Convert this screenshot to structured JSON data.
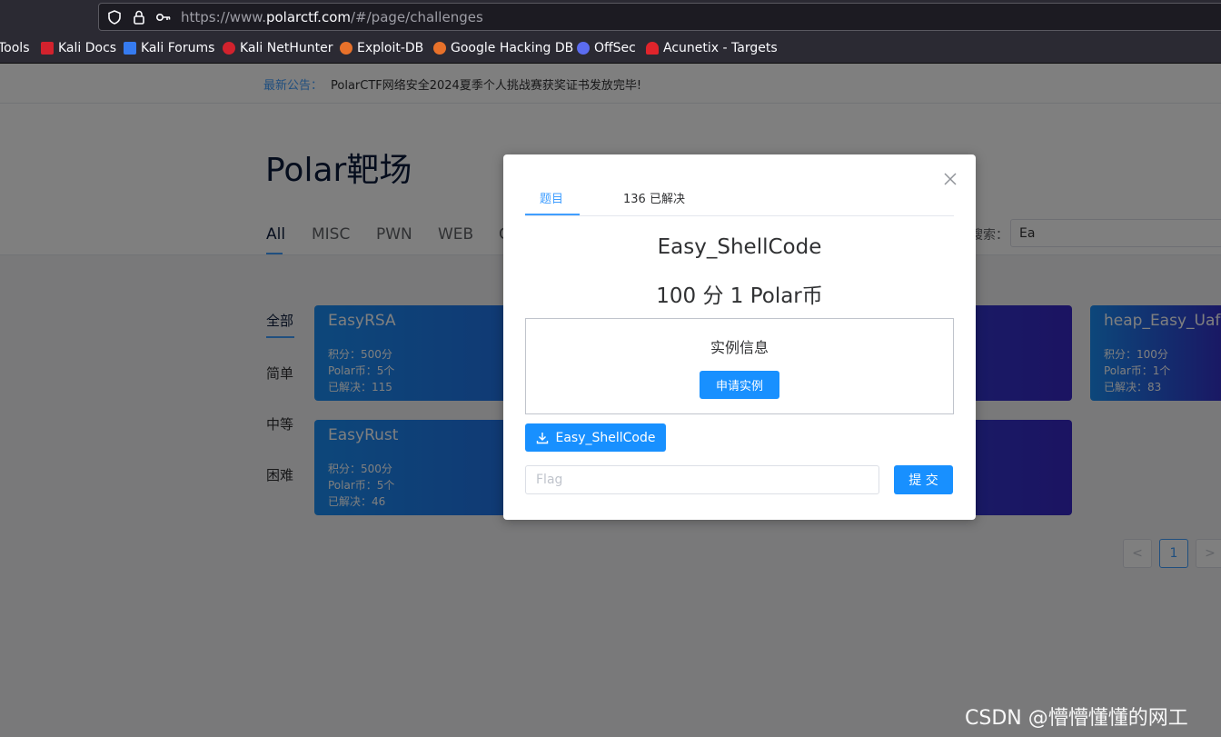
{
  "browser": {
    "url_prefix": "https://www.",
    "url_domain": "polarctf.com",
    "url_path": "/#/page/challenges",
    "bookmarks": [
      {
        "label": "Tools",
        "color": ""
      },
      {
        "label": "Kali Docs",
        "color": "#d2222d"
      },
      {
        "label": "Kali Forums",
        "color": "#367bf0"
      },
      {
        "label": "Kali NetHunter",
        "color": "#d2222d"
      },
      {
        "label": "Exploit-DB",
        "color": "#e8712a"
      },
      {
        "label": "Google Hacking DB",
        "color": "#e8712a"
      },
      {
        "label": "OffSec",
        "color": "#5b6cf0"
      },
      {
        "label": "Acunetix - Targets",
        "color": "#e0242b"
      }
    ]
  },
  "notice": {
    "label": "最新公告：",
    "text": "PolarCTF网络安全2024夏季个人挑战赛获奖证书发放完毕!"
  },
  "page": {
    "title": "Polar靶场",
    "tabs": [
      "All",
      "MISC",
      "PWN",
      "WEB",
      "C"
    ],
    "search_label": "搜索：",
    "search_value": "Ea",
    "difficulty": [
      "全部",
      "简单",
      "中等",
      "困难"
    ]
  },
  "cards": [
    {
      "title": "EasyRSA",
      "score": "积分：500分",
      "coin": "Polar币：5个",
      "solved": "已解决：115"
    },
    {
      "title": "EasyRust",
      "score": "积分：500分",
      "coin": "Polar币：5个",
      "solved": "已解决：46"
    },
    {
      "title": "heap_Easy_Uaf",
      "score": "积分：100分",
      "coin": "Polar币：1个",
      "solved": "已解决：83"
    }
  ],
  "pagination": {
    "prev": "<",
    "current": "1",
    "next": ">"
  },
  "modal": {
    "tabs": [
      "题目",
      "136 已解决"
    ],
    "challenge_name": "Easy_ShellCode",
    "score_line": "100 分 1 Polar币",
    "instance_title": "实例信息",
    "apply_button": "申请实例",
    "download_button": "Easy_ShellCode",
    "flag_placeholder": "Flag",
    "submit_button": "提 交"
  },
  "watermark": "CSDN @懵懵懂懂的网工",
  "colors": {
    "accent": "#409eff",
    "button": "#1890ff",
    "card_start": "#1a8ef5",
    "card_end": "#3727c4"
  }
}
